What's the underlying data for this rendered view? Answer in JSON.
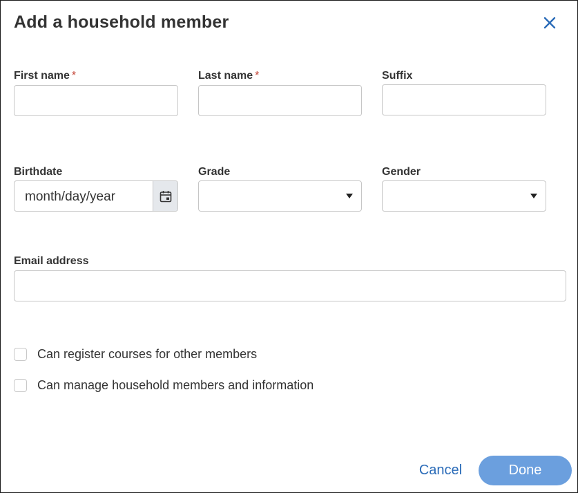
{
  "dialog": {
    "title": "Add a household member",
    "close_icon": "close-icon",
    "accent_color": "#2a6bb8",
    "required_color": "#c0392b"
  },
  "fields": {
    "first_name": {
      "label": "First name",
      "required_mark": "*",
      "value": ""
    },
    "last_name": {
      "label": "Last name",
      "required_mark": "*",
      "value": ""
    },
    "suffix": {
      "label": "Suffix",
      "value": ""
    },
    "birthdate": {
      "label": "Birthdate",
      "placeholder": "month/day/year",
      "icon": "calendar-icon"
    },
    "grade": {
      "label": "Grade",
      "selected": ""
    },
    "gender": {
      "label": "Gender",
      "selected": ""
    },
    "email": {
      "label": "Email address",
      "value": ""
    }
  },
  "permissions": [
    {
      "label": "Can register courses for other members",
      "checked": false
    },
    {
      "label": "Can manage household members and information",
      "checked": false
    }
  ],
  "footer": {
    "cancel_label": "Cancel",
    "done_label": "Done",
    "done_color": "#6b9fde"
  }
}
